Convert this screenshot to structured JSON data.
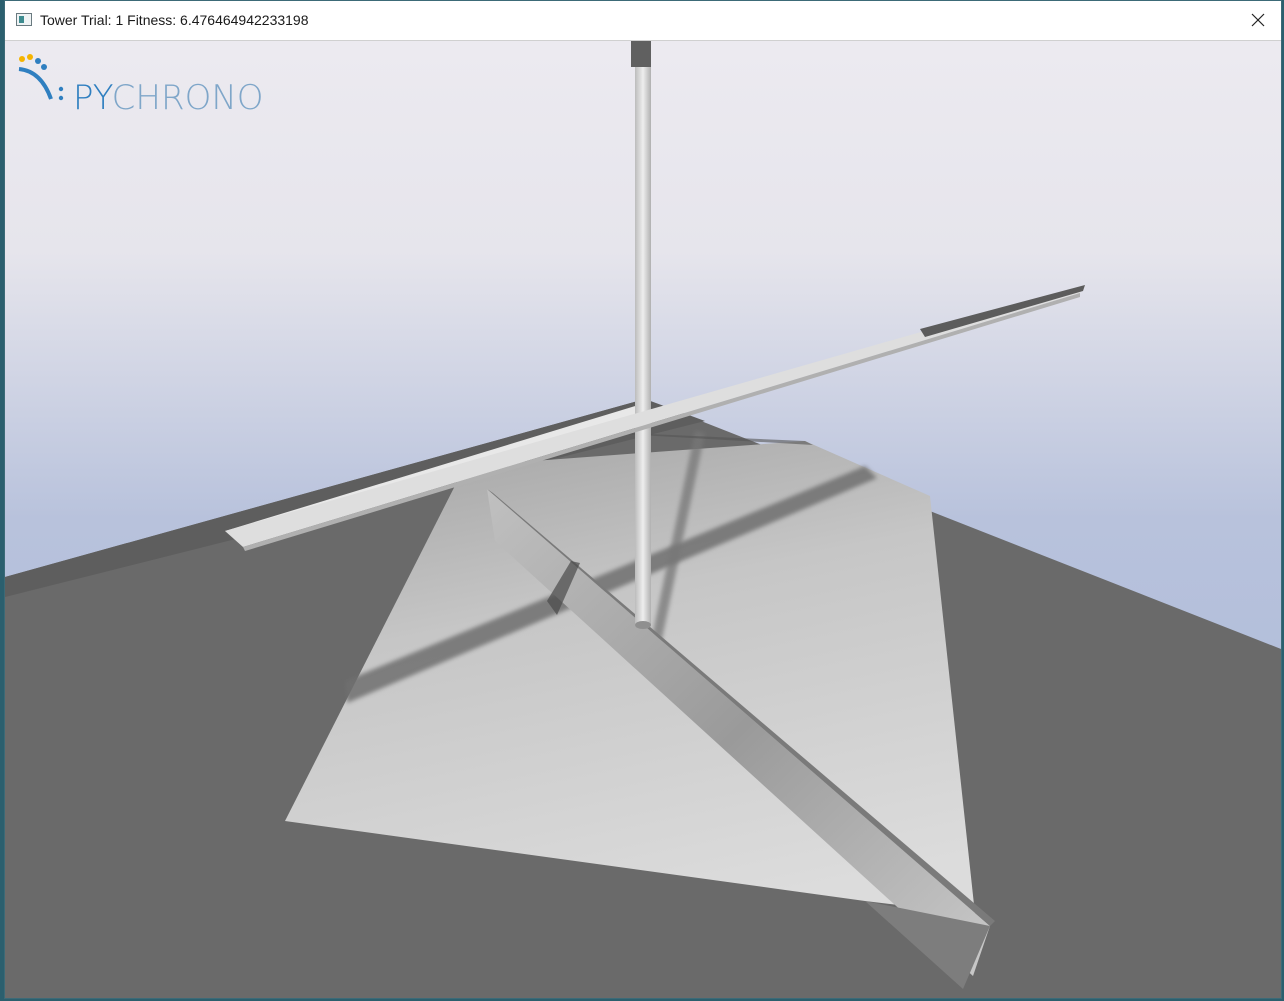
{
  "window": {
    "title": "Tower Trial: 1 Fitness: 6.476464942233198",
    "app_icon": "app-window-icon",
    "close_icon": "close-icon"
  },
  "viewport": {
    "logo": {
      "text_prefix": "PY",
      "text_suffix": "CHRONO",
      "icon": "pychrono-logo-icon"
    },
    "colors": {
      "sky_top": "#eceaef",
      "sky_bottom": "#a9b8d8",
      "floor": "#6a6a6a",
      "base_plate": "#d4d4d4",
      "beam_light": "#e6e6e6",
      "beam_dark": "#8a8a8a",
      "logo_blue": "#2f7fc0",
      "logo_light": "#7fa6c9",
      "logo_orange": "#f5b400"
    }
  }
}
